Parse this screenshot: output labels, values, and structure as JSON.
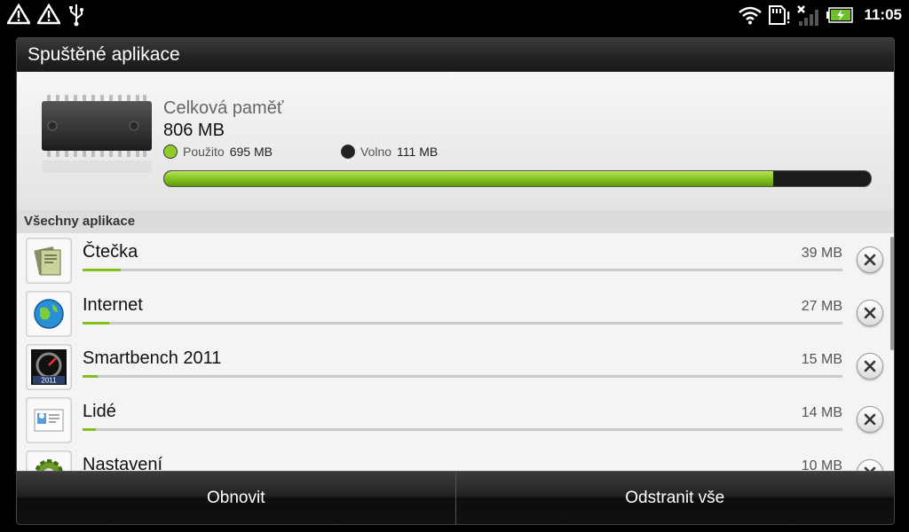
{
  "statusbar": {
    "time": "11:05",
    "left_icons": [
      "warning-icon",
      "warning-icon",
      "usb-icon"
    ],
    "right_icons": [
      "wifi-icon",
      "sd-card-alert-icon",
      "no-signal-icon",
      "battery-charging-icon"
    ]
  },
  "dialog": {
    "title": "Spuštěné aplikace",
    "memory": {
      "title": "Celková paměť",
      "total": "806 MB",
      "used_label": "Použito",
      "used_value": "695 MB",
      "free_label": "Volno",
      "free_value": "111 MB",
      "used_fraction": 0.862,
      "used_color": "#7fbf1c",
      "free_color": "#1c1c1c"
    },
    "section_label": "Všechny aplikace",
    "apps": [
      {
        "name": "Čtečka",
        "size": "39 MB",
        "icon": "reader-icon",
        "fraction": 0.05
      },
      {
        "name": "Internet",
        "size": "27 MB",
        "icon": "globe-icon",
        "fraction": 0.035
      },
      {
        "name": "Smartbench 2011",
        "size": "15 MB",
        "icon": "smartbench-icon",
        "fraction": 0.02
      },
      {
        "name": "Lidé",
        "size": "14 MB",
        "icon": "contacts-icon",
        "fraction": 0.018
      },
      {
        "name": "Nastavení",
        "size": "10 MB",
        "icon": "settings-icon",
        "fraction": 0.013
      }
    ],
    "buttons": {
      "refresh": "Obnovit",
      "remove_all": "Odstranit vše"
    }
  }
}
